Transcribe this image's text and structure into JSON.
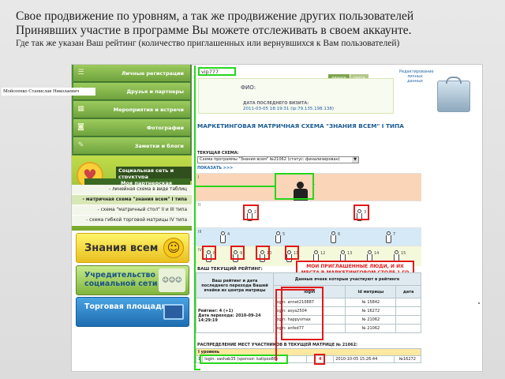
{
  "slide": {
    "heading_line1": "Свое продвижение по уровням, а так же продвижение других пользователей",
    "heading_line2": "Принявших участие в программе Вы можете отслеживать в своем аккаунте.",
    "subline": "Где так же указан Ваш рейтинг (количество приглашенных  или вернувшихся к Вам пользователей)"
  },
  "sidebar": {
    "nav": [
      {
        "label": "Личные регистрации",
        "icon": "list-icon"
      },
      {
        "label": "Друзья и партнеры",
        "icon": "people-icon"
      },
      {
        "label": "Мероприятия и встречи",
        "icon": "calendar-icon"
      },
      {
        "label": "Фотографии",
        "icon": "camera-icon"
      },
      {
        "label": "Заметки и блоги",
        "icon": "notepad-icon"
      }
    ],
    "social_title": "Социальная сеть и структура",
    "structure_link": "Моя партнерская структура >",
    "submenu": [
      "- линейная схема в виде таблиц",
      "- матричная схема \"знания всем\" I типа",
      "- схема \"матричный стол\" II и III типа",
      "- схема гибкой торговой матрицы IV типа"
    ],
    "banners": {
      "znaniya": "Знания всем",
      "uchreditelstvo": "Учредительство социальной сети",
      "torgovaya": "Торговая площадка"
    }
  },
  "name_label": "Мойсеенко Станислав Николаевич",
  "header": {
    "username": "vip777",
    "tabs": [
      "личное",
      "счета"
    ],
    "edit_link": "Редактирование личных данных"
  },
  "profile": {
    "fio_label": "ФИО:",
    "visit_label": "ДАТА ПОСЛЕДНЕГО ВИЗИТА:",
    "visit_value": "2011-03-05 18:19:31 (ip:79.135.198.138)"
  },
  "matrix": {
    "title": "МАРКЕТИНГОВАЯ МАТРИЧНАЯ СХЕМА \"ЗНАНИЯ ВСЕМ\" I ТИПА",
    "scheme_label": "ТЕКУЩАЯ СХЕМА:",
    "scheme_value": "Схема программы \"Знания всем\" №21062 (статус: финализирован)",
    "show_link": "ПОКАЗАТЬ >>>",
    "row_numbers": [
      "I",
      "II",
      "III",
      "IV"
    ],
    "top_number": "1",
    "level2_numbers": [
      "2",
      "3"
    ],
    "level3_numbers": [
      "4",
      "5",
      "6",
      "7"
    ],
    "level4_numbers": [
      "8",
      "9",
      "10",
      "11",
      "12",
      "13",
      "14",
      "15"
    ]
  },
  "rating": {
    "heading": "ВАШ ТЕКУЩИЙ РЕЙТИНГ:",
    "col_left": "Ваш рейтинг и дата последнего перехода Вашей ячейки из центра матрицы",
    "col_right": "Данные ячеек которые участвуют в рейтинге",
    "sub_headers": [
      "login",
      "id матрицы",
      "дата"
    ],
    "rating_text": "Рейтинг: 4 (+1)",
    "transition_text": "Дата перехода: 2010-09-24 14:29:19",
    "rows": [
      {
        "login": "login: annet210887",
        "id": "№ 15842"
      },
      {
        "login": "login: asya2504",
        "id": "№ 16272"
      },
      {
        "login": "login: happyvmax",
        "id": "№ 21062"
      },
      {
        "login": "login: anfed77",
        "id": "№ 21062"
      }
    ]
  },
  "annotation": {
    "red_note": "МОИ ПРИГЛАШЕННЫЕ ЛЮДИ, И ИХ МЕСТА В МАРКЕТИНГОВОМ СТОЛЕ 1 ГО ТИПА"
  },
  "distribution": {
    "heading": "РАСПРЕДЕЛЕНИЕ МЕСТ УЧАСТНИКОВ В ТЕКУЩЕЙ МАТРИЦЕ № 21062:",
    "level_label": "I уровень",
    "row": {
      "num": "1",
      "login": "login: sashab35 (sponsor: katipoo88)",
      "place": "4",
      "date": "2010-10-05 15:26:44",
      "id": "№16272"
    }
  }
}
